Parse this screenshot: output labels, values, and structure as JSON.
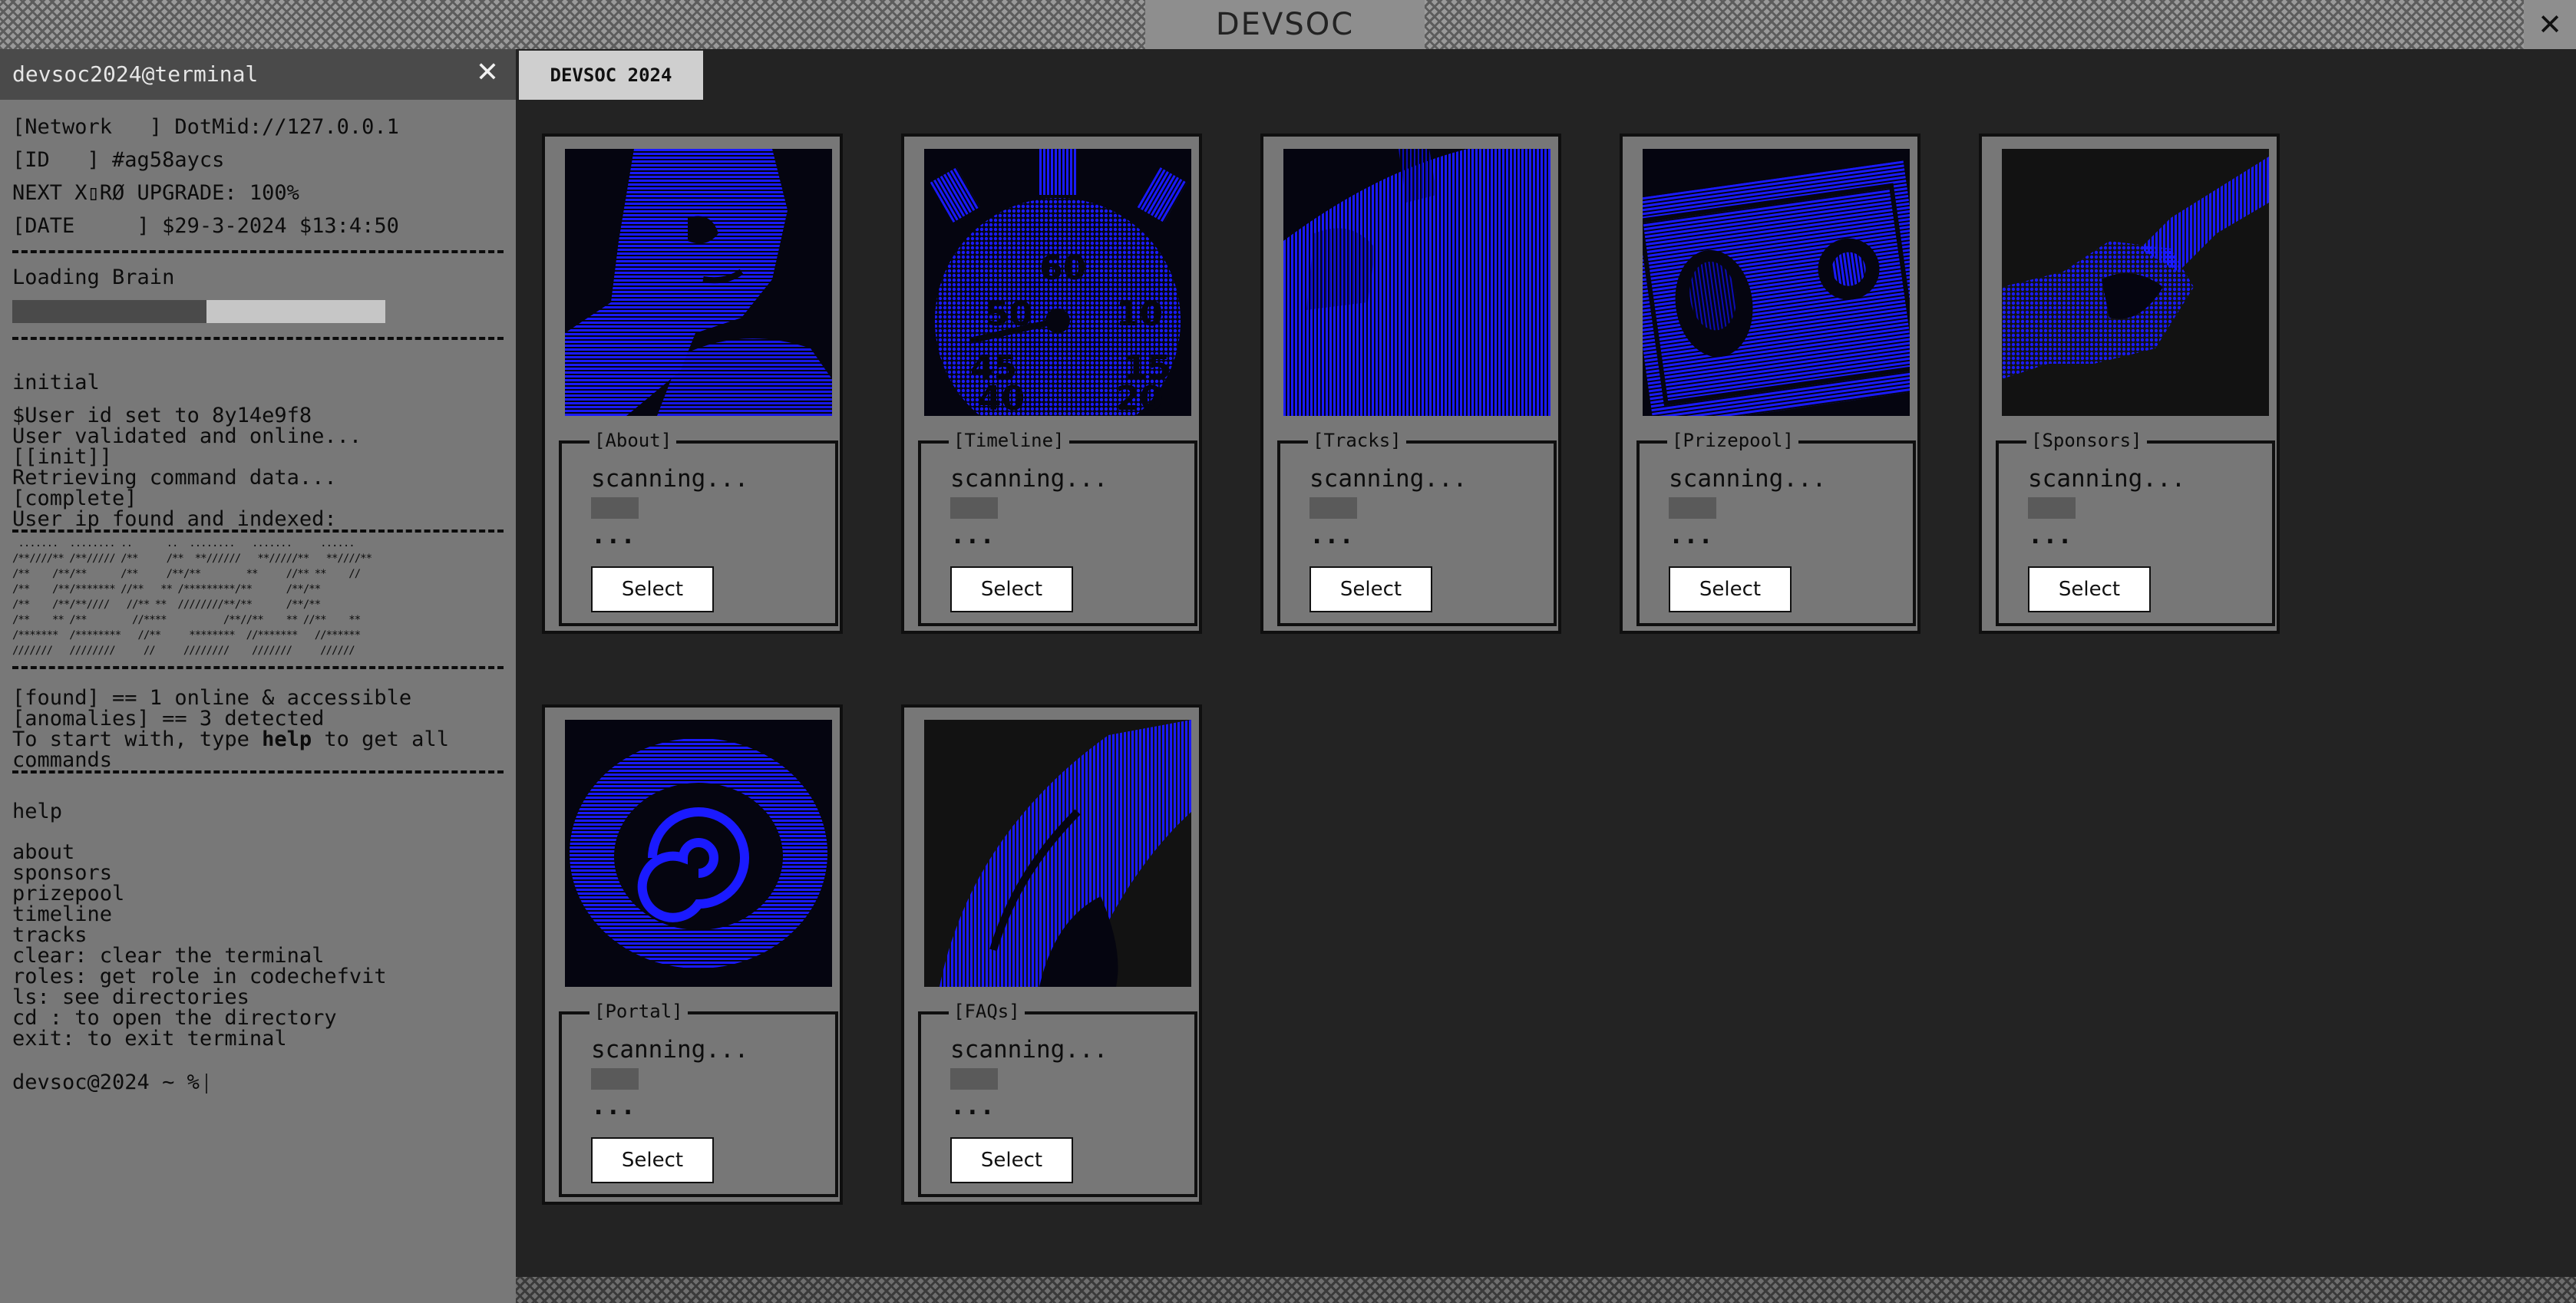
{
  "window": {
    "brand": "DEVSOC",
    "close_glyph": "✕"
  },
  "terminal": {
    "title": "devsoc2024@terminal",
    "close_glyph": "✕",
    "info_lines": [
      "[Network   ] DotMid://127.0.0.1",
      "[ID   ] #ag58aycs",
      "NEXT X▯RØ UPGRADE: 100%",
      "[DATE     ] $29-3-2024 $13:4:50"
    ],
    "loading_label": "Loading Brain",
    "loading_progress": 0.52,
    "initial_label": "initial",
    "log_lines": [
      "$User id set to 8y14e9f8",
      "User validated and online...",
      "[[init]]",
      "Retrieving command data...",
      "[complete]",
      "User ip found and indexed:"
    ],
    "ascii_art": " .......  ........ ..      ..  ........   .......     ......\n/**////** /**///// /**     /**  **//////   **/////**   **////**\n/**    /**/**      /**     /**/**        **     //** **    //\n/**    /**/******* //**   ** /*********/**      /**/**\n/**    /**/**////   //** **  ////////**/**      /**/**\n/**    ** /**        //****          /**//**    ** //**    **\n/*******  /********   //**     ********  //*******   //******\n///////   ////////     //     ////////    ///////     //////",
    "found_lines": [
      "[found] == 1 online & accessible",
      "[anomalies] == 3 detected"
    ],
    "start_prefix": "To start with, type ",
    "start_bold": "help",
    "start_suffix": " to get all",
    "start_line2": "commands",
    "help_label": "help",
    "commands": [
      "about",
      "sponsors",
      "prizepool",
      "timeline",
      "tracks",
      "clear: clear the terminal",
      "roles: get role in codechefvit",
      "ls: see directories",
      "cd : to open the directory",
      "exit: to exit terminal"
    ],
    "prompt": "devsoc@2024 ~ %"
  },
  "tab_label": "DEVSOC 2024",
  "cards": [
    {
      "label": "[About]",
      "icon": "portrait-icon",
      "status": "scanning...",
      "dots": "...",
      "button": "Select"
    },
    {
      "label": "[Timeline]",
      "icon": "stopwatch-icon",
      "status": "scanning...",
      "dots": "...",
      "button": "Select"
    },
    {
      "label": "[Tracks]",
      "icon": "tracks-icon",
      "status": "scanning...",
      "dots": "...",
      "button": "Select"
    },
    {
      "label": "[Prizepool]",
      "icon": "dollar-bill-icon",
      "status": "scanning...",
      "dots": "...",
      "button": "Select"
    },
    {
      "label": "[Sponsors]",
      "icon": "handshake-icon",
      "status": "scanning...",
      "dots": "...",
      "button": "Select"
    },
    {
      "label": "[Portal]",
      "icon": "portal-icon",
      "status": "scanning...",
      "dots": "...",
      "button": "Select"
    },
    {
      "label": "[FAQs]",
      "icon": "faqs-icon",
      "status": "scanning...",
      "dots": "...",
      "button": "Select"
    }
  ],
  "colors": {
    "accent_blue": "#1a1aff",
    "image_bg": "#050510",
    "panel_gray": "#777777"
  }
}
